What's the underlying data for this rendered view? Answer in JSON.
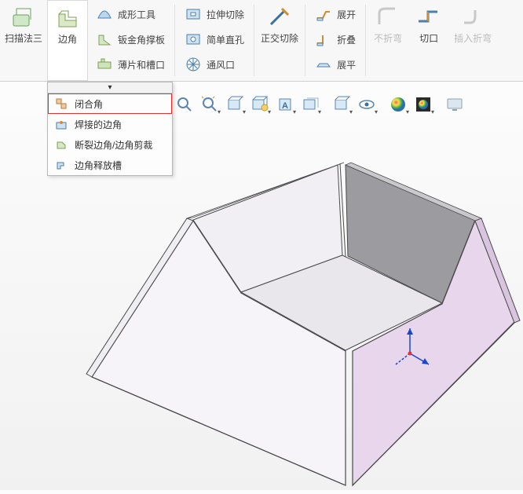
{
  "ribbon": {
    "sweep3": "扫描法三",
    "corner": "边角",
    "forming_tool": "成形工具",
    "gusset": "钣金角撑板",
    "tab_slot": "薄片和槽口",
    "extrude_cut": "拉伸切除",
    "simple_hole": "简单直孔",
    "vent": "通风口",
    "normal_cut": "正交切除",
    "unfold": "展开",
    "fold": "折叠",
    "flatten": "展平",
    "no_bend": "不折弯",
    "cut": "切口",
    "insert_bend": "插入折弯"
  },
  "dropdown": {
    "items": [
      "闭合角",
      "焊接的边角",
      "断裂边角/边角剪裁",
      "边角释放槽"
    ]
  },
  "colors": {
    "face_light": "#f5f4f6",
    "face_purple": "#e8d6ec",
    "face_grey": "#9c9ca0",
    "edge": "#4a4a4a"
  },
  "triad": {
    "x": "x",
    "y": "y",
    "z": "z"
  }
}
